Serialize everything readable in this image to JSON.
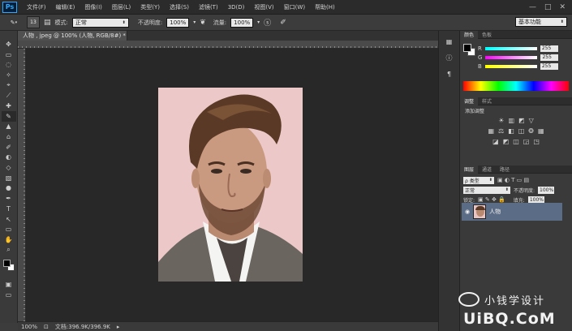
{
  "app": {
    "logo": "Ps"
  },
  "menu": [
    "文件(F)",
    "编辑(E)",
    "图像(I)",
    "图层(L)",
    "类型(Y)",
    "选择(S)",
    "滤镜(T)",
    "3D(D)",
    "视图(V)",
    "窗口(W)",
    "帮助(H)"
  ],
  "window_controls": [
    "—",
    "□",
    "✕"
  ],
  "options": {
    "brush_size": "13",
    "mode_label": "模式:",
    "mode_value": "正常",
    "opacity_label": "不透明度:",
    "opacity_value": "100%",
    "flow_label": "流量:",
    "flow_value": "100%",
    "workspace": "基本功能"
  },
  "document": {
    "tab_title": "人物 , jpeg @ 100% (人物, RGB/8#) *",
    "zoom": "100%",
    "doc_info": "文档:396.9K/396.9K"
  },
  "tools": [
    "✥",
    "▭",
    "◌",
    "✧",
    "⌖",
    "⟋",
    "✚",
    "✎",
    "▲",
    "⌂",
    "✐",
    "◐",
    "◇",
    "▧",
    "●",
    "✒",
    "T",
    "↖",
    "▭",
    "✋",
    "⌕"
  ],
  "panels": {
    "color_tabs": [
      "颜色",
      "色板"
    ],
    "rgb": [
      {
        "label": "R",
        "value": "255",
        "color": "#ff4d4d"
      },
      {
        "label": "G",
        "value": "255",
        "color": "#4dff4d"
      },
      {
        "label": "B",
        "value": "255",
        "color": "#5b7bff"
      }
    ],
    "adjust_tabs": [
      "调整",
      "样式"
    ],
    "adjust_title": "添加调整",
    "adjust_rows": [
      [
        "☀",
        "▥",
        "◩",
        "▽"
      ],
      [
        "▦",
        "⚖",
        "◧",
        "◫",
        "❂",
        "▦"
      ],
      [
        "◪",
        "◩",
        "◫",
        "◲",
        "◳"
      ]
    ],
    "layers_tabs": [
      "图层",
      "通道",
      "路径"
    ],
    "kind_label": "ρ 类型",
    "blend_value": "正常",
    "opacity_label": "不透明度:",
    "opacity_value": "100%",
    "lock_label": "锁定:",
    "fill_label": "填充:",
    "fill_value": "100%",
    "layer_name": "人物"
  },
  "watermark": {
    "line1": "小钱学设计",
    "line2": "UiBQ.CoM"
  }
}
